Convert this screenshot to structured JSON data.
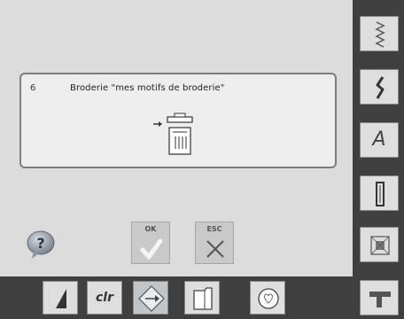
{
  "dialog": {
    "message_number": "6",
    "message_text": "Broderie \"mes motifs de broderie\""
  },
  "buttons": {
    "ok_label": "OK",
    "esc_label": "ESC"
  },
  "sidebar": {
    "text_button_letter": "A"
  },
  "bottombar": {
    "clr_label": "clr"
  },
  "icons": {
    "help": "question-bubble-icon",
    "ok": "checkmark-icon",
    "esc": "x-mark-icon",
    "storage": "memory-storage-icon"
  }
}
